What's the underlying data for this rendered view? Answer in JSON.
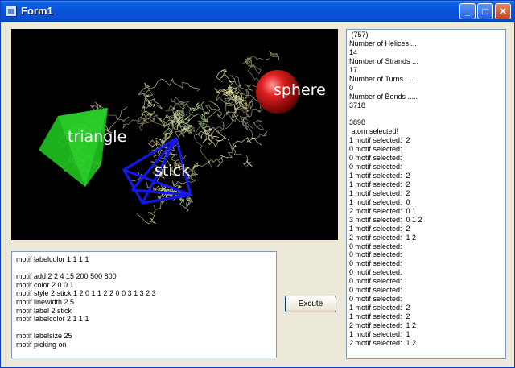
{
  "window": {
    "title": "Form1",
    "minimize_label": "_",
    "maximize_label": "□",
    "close_label": "✕"
  },
  "viewer": {
    "labels": {
      "sphere": "sphere",
      "triangle": "triangle",
      "stick": "stick"
    },
    "colors": {
      "background": "#000000",
      "sphere": "#e02020",
      "triangle": "#22cc22",
      "stick": "#1010e0",
      "backbone": "#e8e6a0"
    }
  },
  "script": {
    "lines": [
      "motif labelcolor 1 1 1 1",
      "",
      "motif add 2 2 4 15 200 500 800",
      "motif color 2 0 0 1",
      "motif style 2 stick 1 2 0 1 1 2 2 0 0 3 1 3 2 3",
      "motif linewidth 2 5",
      "motif label 2 stick",
      "motif labelcolor 2 1 1 1",
      "",
      "motif labelsize 25",
      "motif picking on"
    ]
  },
  "execute_button": {
    "label": "Excute"
  },
  "log": {
    "lines": [
      " (757)",
      "Number of Helices ...",
      "14",
      "Number of Strands ...",
      "17",
      "Number of Turns .....",
      "0",
      "Number of Bonds .....",
      "3718",
      "",
      "3898",
      " atom selected!",
      "1 motif selected:  2",
      "0 motif selected:",
      "0 motif selected:",
      "0 motif selected:",
      "1 motif selected:  2",
      "1 motif selected:  2",
      "1 motif selected:  2",
      "1 motif selected:  0",
      "2 motif selected:  0 1",
      "3 motif selected:  0 1 2",
      "1 motif selected:  2",
      "2 motif selected:  1 2",
      "0 motif selected:",
      "0 motif selected:",
      "0 motif selected:",
      "0 motif selected:",
      "0 motif selected:",
      "0 motif selected:",
      "0 motif selected:",
      "1 motif selected:  2",
      "1 motif selected:  2",
      "2 motif selected:  1 2",
      "1 motif selected:  1",
      "2 motif selected:  1 2"
    ]
  }
}
